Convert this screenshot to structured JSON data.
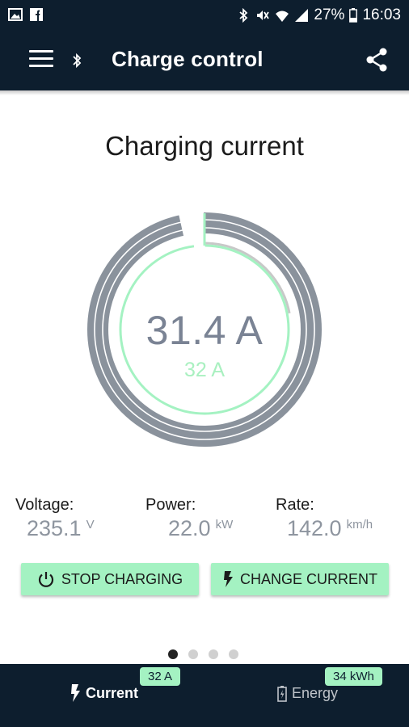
{
  "status_bar": {
    "left_icons": [
      "image-icon",
      "facebook-icon"
    ],
    "right_icons": [
      "bluetooth-icon",
      "mute-icon",
      "wifi-icon",
      "signal-icon"
    ],
    "battery_percent": "27%",
    "time": "16:03"
  },
  "app_bar": {
    "title": "Charge control",
    "left_icons": [
      "menu-icon",
      "bluetooth-icon"
    ],
    "right_icon": "share-icon"
  },
  "page": {
    "heading": "Charging current"
  },
  "gauge": {
    "current_value": "31.4 A",
    "set_value": "32 A",
    "measured_fraction": 0.98,
    "setpoint_fraction": 1.0,
    "colors": {
      "track": "#8a929c",
      "accent": "#a4f2c2",
      "setpoint": "#c8c8c8"
    }
  },
  "stats": [
    {
      "label": "Voltage:",
      "value": "235.1",
      "unit": "V"
    },
    {
      "label": "Power:",
      "value": "22.0",
      "unit": "kW"
    },
    {
      "label": "Rate:",
      "value": "142.0",
      "unit": "km/h"
    }
  ],
  "buttons": {
    "stop_label": "STOP CHARGING",
    "change_label": "CHANGE CURRENT"
  },
  "pager": {
    "count": 4,
    "active_index": 0
  },
  "bottom_nav": {
    "items": [
      {
        "label": "Current",
        "badge": "32 A",
        "icon": "lightning-icon"
      },
      {
        "label": "Energy",
        "badge": "34 kWh",
        "icon": "battery-icon"
      }
    ]
  },
  "colors": {
    "navy": "#0d1e2e",
    "accent": "#a4f2c2",
    "text_gray": "#8e959f"
  }
}
